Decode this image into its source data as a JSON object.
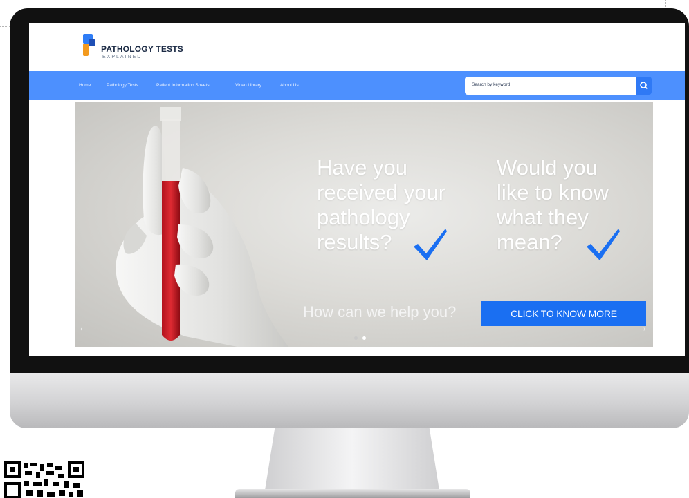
{
  "site": {
    "logo_title": "PATHOLOGY TESTS",
    "logo_subtitle": "EXPLAINED"
  },
  "nav": {
    "items": [
      "Home",
      "Pathology Tests",
      "Patient Information Sheets",
      "Video Library",
      "About Us"
    ],
    "search_placeholder": "Search by keyword"
  },
  "hero": {
    "left_lines": [
      "Have you",
      "received your",
      "pathology",
      "results?"
    ],
    "right_lines": [
      "Would you",
      "like to know",
      "what they",
      "mean?"
    ],
    "help_text": "How can we help you?",
    "cta_label": "CLICK TO KNOW MORE",
    "prev_arrow": "‹",
    "next_arrow": "›",
    "slide_count": 2,
    "active_slide": 2
  },
  "colors": {
    "nav_bar": "#4d90fe",
    "cta": "#1a6ff2",
    "check": "#1a6ff2"
  },
  "icons": [
    "logo-icon",
    "search-icon",
    "checkmark-icon",
    "qr-code-icon"
  ]
}
